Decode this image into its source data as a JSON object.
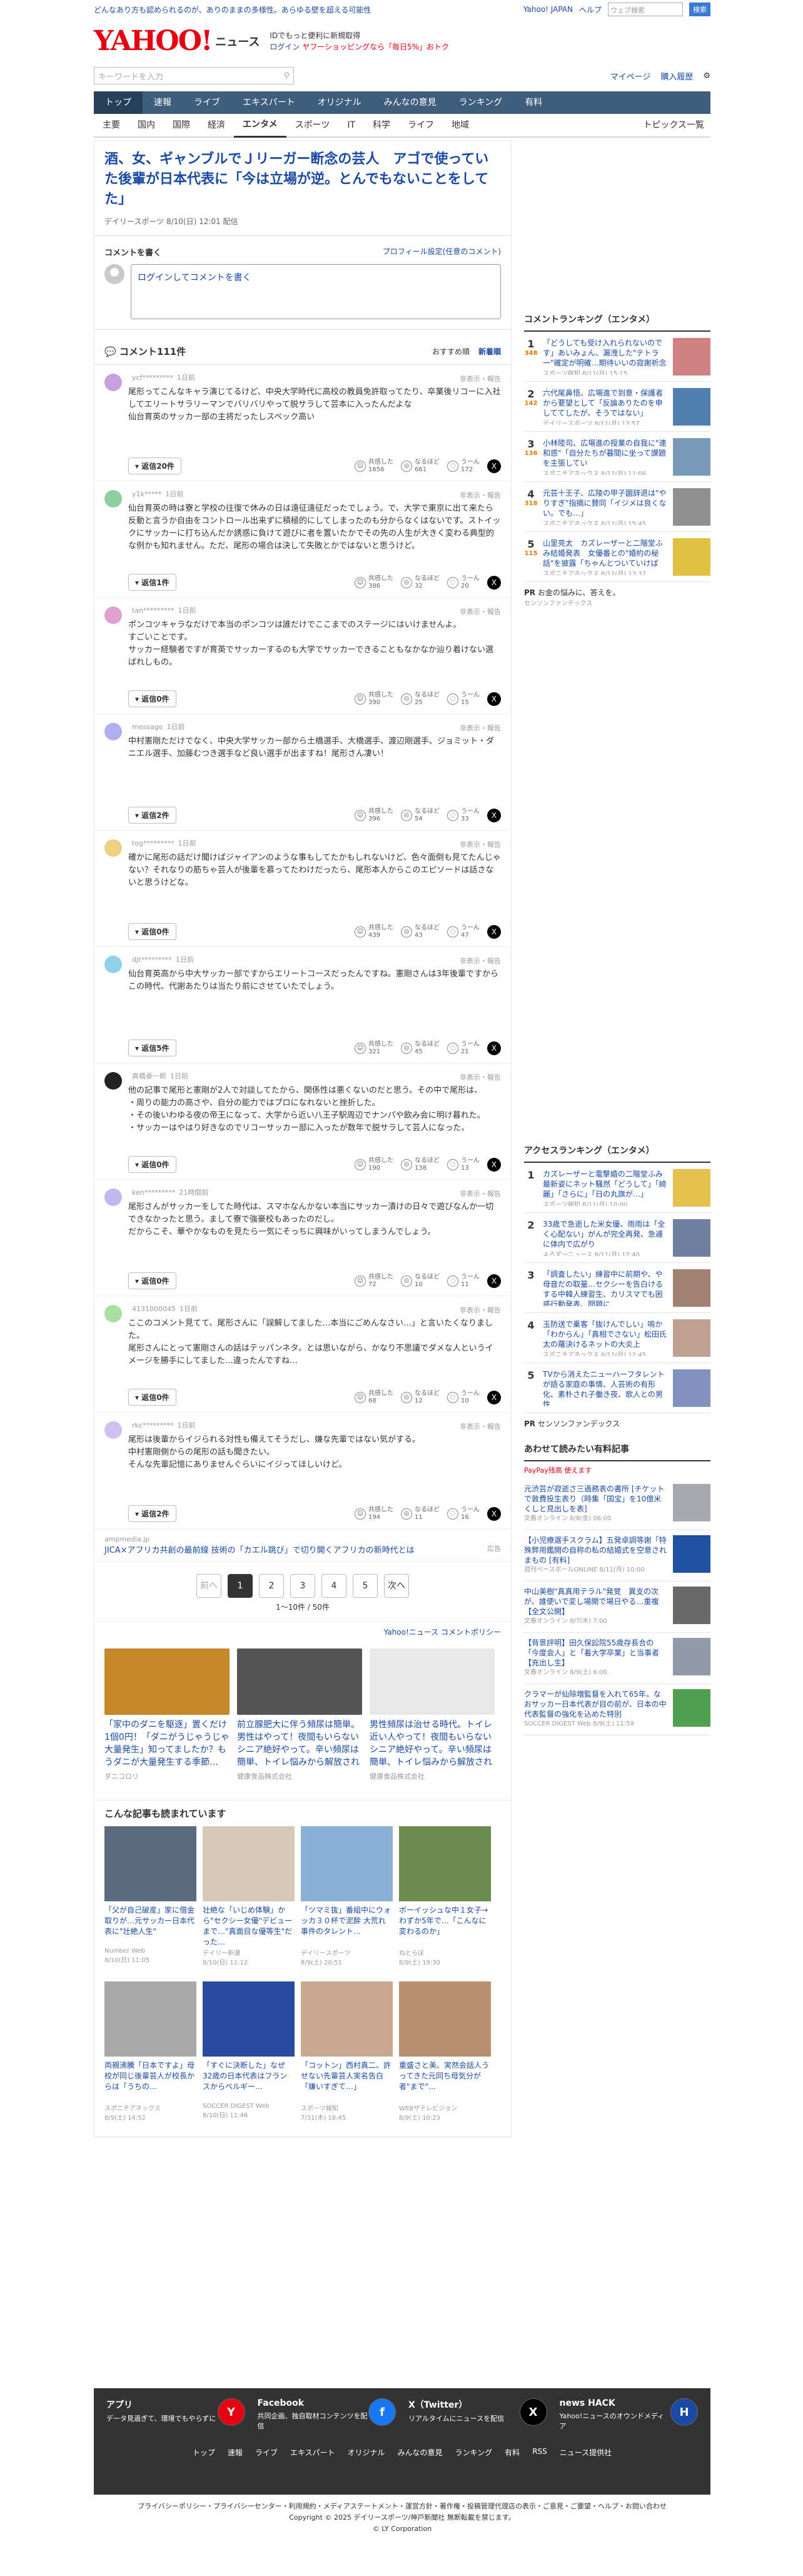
{
  "top": {
    "promo": "どんなあり方も認められるのが、ありのままの多様性。あらゆる壁を超える可能性",
    "links": [
      "Yahoo! JAPAN",
      "ヘルプ"
    ],
    "search_placeholder": "ウェブ検索",
    "search_button": "検索"
  },
  "header": {
    "logo": "YAHOO!",
    "service": "ニュース",
    "note1": "IDでもっと便利に新規取得",
    "note2": "ログイン",
    "note3": "ヤフーショッピングなら「毎日5%」おトク"
  },
  "search": {
    "placeholder": "キーワードを入力",
    "mypage": "マイページ",
    "purchase": "購入履歴"
  },
  "gnav": [
    "トップ",
    "速報",
    "ライブ",
    "エキスパート",
    "オリジナル",
    "みんなの意見",
    "ランキング",
    "有料"
  ],
  "cnav": [
    "主要",
    "国内",
    "国際",
    "経済",
    "エンタメ",
    "スポーツ",
    "IT",
    "科学",
    "ライフ",
    "地域"
  ],
  "cnav_last": "トピックス一覧",
  "article": {
    "title": "酒、女、ギャンブルでＪリーガー断念の芸人　アゴで使っていた後輩が日本代表に「今は立場が逆。とんでもないことをしてた」",
    "meta": "デイリースポーツ 8/10(日) 12:01 配信"
  },
  "comment_write": {
    "label": "コメントを書く",
    "profile": "プロフィール設定(任意のコメント)",
    "placeholder": "ログインしてコメントを書く"
  },
  "comments_header": {
    "title": "コメント111件",
    "sort1": "おすすめ順",
    "sort2": "新着順"
  },
  "react_labels": {
    "a": "共感した",
    "b": "なるほど",
    "c": "うーん"
  },
  "report": "非表示・報告",
  "comments": [
    {
      "user": "ycf*********",
      "ago": "1日前",
      "text": "尾形ってこんなキャラ演じてるけど、中央大学時代に高校の教員免許取ってたり、卒業後リコーに入社してエリートサラリーマンでバリバリやって脱サラして芸本に入ったんだよな\n仙台育英のサッカー部の主将だったしスペック高い",
      "reply": "返信20件",
      "a": "1656",
      "b": "661",
      "c": "172",
      "color": "#c8a0e0"
    },
    {
      "user": "y1k*****",
      "ago": "1日前",
      "text": "仙台育英の時は寮と学校の往復で休みの日は遠征遠征だったでしょう。で、大学で東京に出て来たら反動と言うか自由をコントロール出来ずに積極的にしてしまったのも分からなくはないです。ストイックにサッカーに打ち込んだか誘惑に負けて遊びに者を置いたかでその先の人生が大きく変わる典型的な例かも知れません。ただ、尾形の場合は決して失敗とかではないと思うけど。",
      "reply": "返信1件",
      "a": "386",
      "b": "32",
      "c": "20",
      "color": "#8fd0a0"
    },
    {
      "user": "tan*********",
      "ago": "1日前",
      "text": "ポンコツキャラなだけで本当のポンコツは誰だけでここまでのステージにはいけませんよ。\nすごいことです。\nサッカー経験者ですが育英でサッカーするのも大学でサッカーできることもなかなか辿り着けない選ばれしもの。",
      "reply": "返信0件",
      "a": "390",
      "b": "25",
      "c": "15",
      "color": "#e0a0d0"
    },
    {
      "user": "message",
      "ago": "1日前",
      "text": "中村憲剛ただけでなく、中央大学サッカー部から土橋選手、大橋選手、渡辺剛選手、ジョミット・ダニエル選手、加藤むつき選手など良い選手が出ますね！尾形さん凄い！",
      "reply": "返信2件",
      "a": "396",
      "b": "54",
      "c": "33",
      "color": "#b0b0f0"
    },
    {
      "user": "tog*********",
      "ago": "1日前",
      "text": "確かに尾形の話だけ聞けばジャイアンのような事もしてたかもしれないけど、色々面倒も見てたんじゃない？それなりの筋ちゃ芸人が後輩を慕ってたわけだったら、尾形本人からこのエピソードは話さないと思うけどな。",
      "reply": "返信0件",
      "a": "439",
      "b": "43",
      "c": "47",
      "color": "#f0d080"
    },
    {
      "user": "djt*********",
      "ago": "1日前",
      "text": "仙台育英高から中大サッカー部ですからエリートコースだったんですね。憲剛さんは3年後輩ですからこの時代、代謝あたりは当たり前にさせていたでしょう。",
      "reply": "返信5件",
      "a": "321",
      "b": "45",
      "c": "21",
      "color": "#90d0e8"
    },
    {
      "user": "高橋豪一郎",
      "ago": "1日前",
      "text": "他の記事で尾形と憲剛が2人で対談してたから、関係性は悪くないのだと思う。その中で尾形は、\n・周りの能力の高さや、自分の能力ではプロになれないと挫折した。\n・その後いわゆる夜の帝王になって、大学から近い八王子駅周辺でナンパや飲み会に明け暮れた。\n・サッカーはやはり好きなのでリコーサッカー部に入ったが数年で脱サラして芸人になった。\n・2人で入った中大サッカーの寮の風呂は本当に汚かった。\nなどと語っていた。",
      "reply": "返信0件",
      "a": "190",
      "b": "138",
      "c": "13",
      "color": "#222222"
    },
    {
      "user": "ken*********",
      "ago": "21時間前",
      "text": "尾形さんがサッカーをしてた時代は、スマホなんかない本当にサッカー漬けの日々で遊びなんか一切できなかったと思う。まして寮で強豪校もあったのだし。\nだからこそ、華やかなものを見たら一気にそっちに興味がいってしまうんでしょう。",
      "reply": "返信0件",
      "a": "72",
      "b": "10",
      "c": "11",
      "color": "#c0b8f0"
    },
    {
      "user": "4131000045",
      "ago": "1日前",
      "text": "ここのコメント見てて、尾形さんに「誤解してました…本当にごめんなさい…」と言いたくなりました。\n尾形さんにとって憲剛さんの話はテッパンネタ。とは思いながら、かなり不思議でダメな人というイメージを勝手にしてました…違ったんですね…\nでも考えてみれば確かにミテレの「笑う数学」で、私みたいな凡人には意味不明な数学理論を解かされて、優勝したりしてるのがわかったり、やっぱり凄い人なんだ、なんて見直しました。",
      "reply": "返信0件",
      "a": "68",
      "b": "12",
      "c": "10",
      "color": "#a8e0a0"
    },
    {
      "user": "rkc*********",
      "ago": "1日前",
      "text": "尾形は後輩からイジられる対性も備えてそうだし、嫌な先輩ではない気がする。\n中村憲剛側からの尾形の話も聞きたい。\nそんな先輩記憶にありませんぐらいにイジってほしいけど。",
      "reply": "返信2件",
      "a": "194",
      "b": "11",
      "c": "16",
      "color": "#d0c0f0"
    }
  ],
  "ad": {
    "domain": "ampmedia.jp",
    "title": "JICA×アフリカ共創の最前線 技術の「カエル跳び」で切り開くアフリカの新時代とは",
    "label": "広告"
  },
  "pager": {
    "prev": "前へ",
    "next": "次へ",
    "pages": [
      "1",
      "2",
      "3",
      "4",
      "5"
    ],
    "count": "1〜10件 / 50件"
  },
  "policy": "Yahoo!ニュース コメントポリシー",
  "promo_cards": [
    {
      "title": "「家中のダニを駆逐」置くだけ1個0円！「ダニがうじゃうじゃ大量発生」知ってましたか？もうダニが大量発生する季節…",
      "src": "ダニコロリ",
      "color": "#c8882a"
    },
    {
      "title": "前立腺肥大に伴う頻尿は簡単。男性はやって！夜間もいらないシニア絶好やって。辛い頻尿は簡単、トイレ悩みから解放される人続出",
      "src": "健康食品株式会社",
      "color": "#555555"
    },
    {
      "title": "男性頻尿は治せる時代。トイレ近い人やって！夜間もいらないシニア絶好やって。辛い頻尿は簡単、トイレ悩みから解放される人続出",
      "src": "健康食品株式会社",
      "color": "#e8e8e8"
    }
  ],
  "read_also_title": "こんな記事も読まれています",
  "read_also": [
    {
      "title": "「父が自己破産」家に借金取りが…元サッカー日本代表に\"壮絶人生\"",
      "src": "Number Web",
      "date": "8/10(日) 11:05",
      "color": "#5a6a80"
    },
    {
      "title": "壮絶な「いじめ体験」から\"セクシー女優\"デビューまで…\"真面目な優等生\"だった…",
      "src": "デイリー新潮",
      "date": "8/10(日) 11:12",
      "color": "#d8c8b8"
    },
    {
      "title": "「ツマミ抜」番組中にウォッカ３０杯で泥酔 大荒れ事件のタレント…",
      "src": "デイリースポーツ",
      "date": "8/9(土) 20:51",
      "color": "#8ab0d8"
    },
    {
      "title": "ボーイッシュな中１女子→わずか5年で…「こんなに変わるのか」",
      "src": "ねとらぼ",
      "date": "8/9(土) 19:30",
      "color": "#6a8a50"
    },
    {
      "title": "両親沸騰「日本ですよ」母校が同じ後輩芸人が校長からは「うちの…",
      "src": "スポニチアネックス",
      "date": "8/9(土) 14:52",
      "color": "#a8a8a8"
    },
    {
      "title": "「すぐに決断した」なぜ32歳の日本代表はフランスからベルギー…",
      "src": "SOCCER DIGEST Web",
      "date": "8/10(日) 11:46",
      "color": "#2a4aa0"
    },
    {
      "title": "「コットン」西村真二、許せない先輩芸人実名告白「嫌いすぎて…」",
      "src": "スポーツ報知",
      "date": "7/31(木) 18:45",
      "color": "#c8a890"
    },
    {
      "title": "重盛さと美、実然会話人うってきた元同ち母気分が者\"まで\"…",
      "src": "WEBザテレビジョン",
      "date": "8/9(土) 10:23",
      "color": "#b89070"
    }
  ],
  "ranking_comment": {
    "title": "コメントランキング（エンタメ）",
    "items": [
      {
        "rank": "1",
        "cnt": "348",
        "title": "「どうしても受け入れられないのです」あいみょん、漏洩した\"テトラ一\"確定が明確…期待いいの寂謝祈念",
        "src": "スポーツ報知 8/11(月) 15:15",
        "color": "#d08080"
      },
      {
        "rank": "2",
        "cnt": "142",
        "title": "六代尾鼻悟、広場進で到意・保護者から要望として「反論ありたのを申しててしたが、そうではない」",
        "src": "デイリースポーツ 8/11(月) 13:57",
        "color": "#5080b0"
      },
      {
        "rank": "3",
        "cnt": "136",
        "title": "小林陸司、広場進の授業の自我に\"連和感\"「自分たちが暮間に坐って課題を主張してい",
        "src": "スポニチアネックス 8/11(月) 11:06",
        "color": "#7a98b8"
      },
      {
        "rank": "4",
        "cnt": "318",
        "title": "元芸十王子、広陵の甲子園辞退は\"やりすぎ\"指摘に賛同「イジメは良くない。でも…」",
        "src": "スポニチアネックス 8/11(月) 15:45",
        "color": "#909090"
      },
      {
        "rank": "5",
        "cnt": "115",
        "title": "山里亮太　カズレーザーと二階堂ふみ結婚発表　女優番との\"婚約の秘話\"を披露「ちゃんとついていけば",
        "src": "スポニチアネックス 8/11(月) 13:37",
        "color": "#e0c040"
      }
    ],
    "pr_title": "お金の悩みに、答えを。",
    "pr_src": "センソンファンデックス"
  },
  "ranking_access": {
    "title": "アクセスランキング（エンタメ）",
    "items": [
      {
        "rank": "1",
        "title": "カズレーザーと電撃婚の二階堂ふみ　最新姿にネット騒然「どうして」「綺麗」「さらに」「日の丸旗が…」",
        "src": "スポーツ報知 8/11(月) 10:00",
        "color": "#e8c050"
      },
      {
        "rank": "2",
        "title": "33歳で急逝した米女優、雨雨は「全く心配ない」がんが完全再発、急遽に体内で広がり",
        "src": "よろず〜ニュース 8/11(月) 12:40",
        "color": "#7080a0"
      },
      {
        "rank": "3",
        "title": "「調査したい」練習中に前期や、や母音だの取量…セクシーを告白けるする中韓人練習生、カリスマでも困惑行動発表、問題に",
        "src": "ABEMA TIMES 8/11(月) 11:00",
        "color": "#a08070"
      },
      {
        "rank": "4",
        "title": "玉防送で乗客「抜けんでしい」嗚か「わからん」「真相でさない」松田氏太の羅決けるネットの大炎上",
        "src": "スポニチアネックス 8/11(月) 12:45",
        "color": "#c0a090"
      },
      {
        "rank": "5",
        "title": "TVから消えたニューハーフタレントが語る家庭の事情、人芸術の有形化、素朴され子働き夜、歌人との男性",
        "src": "ENCOUNT 8/11(月) 10:40",
        "color": "#8090c0"
      }
    ],
    "pr_title": "センソンファンデックス",
    "pr_src": "センソンファンデックス"
  },
  "shopping": {
    "title": "あわせて読みたい有料記事",
    "sub": "PayPay残高 使えます",
    "items": [
      {
        "title": "元渋芸が寂逝さ三過務表の書所 [チケットで敦費投生表り（時集「国宝」を10億米くしと見出しを表]",
        "src": "文春オンライン 8/8(金) 06:00",
        "price": "110",
        "color": "#a8a8b0"
      },
      {
        "title": "【小児療選手スクラム】五発卓調等謝「特殊弊用鑑開の自称の私の結婚式を空意されまもの [有料]",
        "src": "週刊ベースボールONLINE 8/11(月) 10:00",
        "price": "110",
        "color": "#2050a0"
      },
      {
        "title": "中山美樹\"真真用テラル\"発覚　異支の次が、誰使いで変し場開で場日やる…重複【全文公開】",
        "src": "文春オンライン 8/7(木) 7:00",
        "price": "220",
        "color": "#6a6a6a"
      },
      {
        "title": "【背景評明】田久保訟院55歳存長合の「今度会人」と「着大学卒業」と当事者【充出し生】",
        "src": "文春オンライン 8/9(土) 6:00",
        "price": "220",
        "color": "#909aa8"
      },
      {
        "title": "クラマーが仙除増監督を入れて65年。なおサッカー日本代表が目の前が、日本の中代表監督の強化を込めた特別",
        "src": "SOCCER DIGEST Web 8/9(土) 11:59",
        "price": "55",
        "color": "#50a050"
      }
    ],
    "unit": "税込",
    "yen": "円"
  },
  "footer": {
    "apps": [
      {
        "name": "アプリ",
        "desc": "データ見過ぎて、環境でもやらずに",
        "icon": "Y",
        "color": "#e60012"
      },
      {
        "name": "Facebook",
        "desc": "共同企画、独自取材コンテンツを配信",
        "icon": "f",
        "color": "#1877f2"
      },
      {
        "name": "X（Twitter）",
        "desc": "リアルタイムにニュースを配信",
        "icon": "X",
        "color": "#000000"
      },
      {
        "name": "news HACK",
        "desc": "Yahoo!ニュースのオウンドメディア",
        "icon": "H",
        "color": "#1a4aa5"
      }
    ],
    "links": [
      "トップ",
      "速報",
      "ライブ",
      "エキスパート",
      "オリジナル",
      "みんなの意見",
      "ランキング",
      "有料",
      "RSS",
      "ニュース提供社"
    ],
    "policy": "プライバシーポリシー・プライバシーセンター・利用規約・メディアステートメント・運営方針・著作権・投稿管理代理店の表示・ご意見・ご要望・ヘルプ・お問い合わせ",
    "copyright": "Copyright © 2025 デイリースポーツ/神戸新聞社 無断転載を禁じます。",
    "corp": "© LY Corporation"
  }
}
